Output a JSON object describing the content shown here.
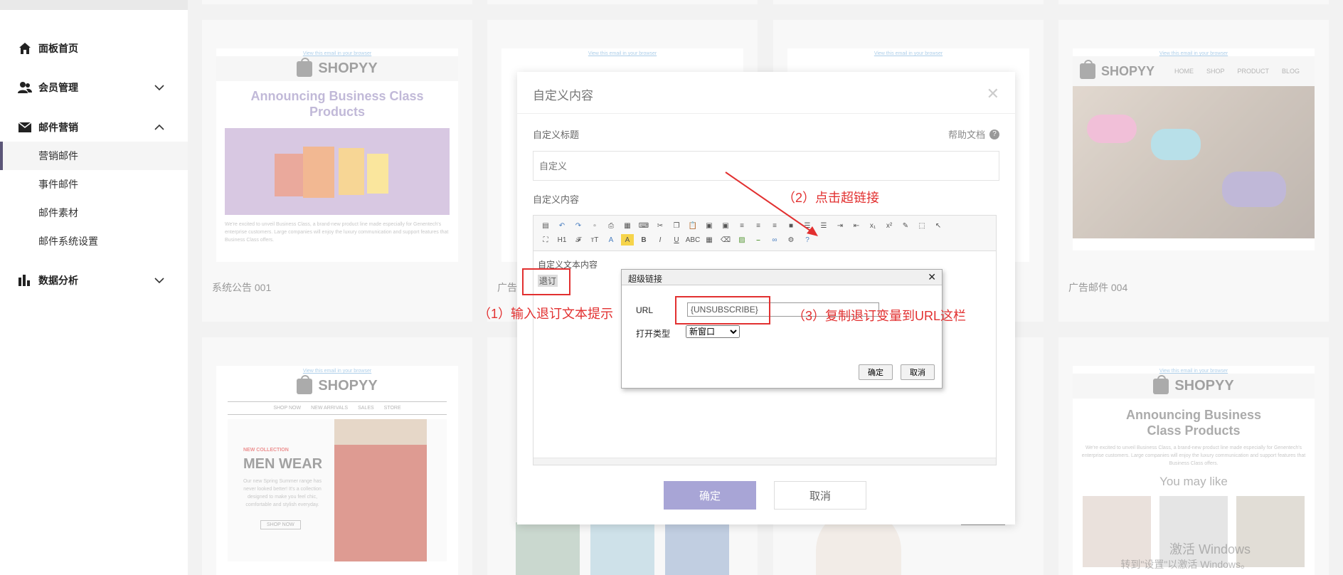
{
  "sidebar": {
    "items": [
      {
        "label": "面板首页",
        "icon": "home-icon"
      },
      {
        "label": "会员管理",
        "icon": "members-icon"
      },
      {
        "label": "邮件营销",
        "icon": "mail-icon"
      },
      {
        "label": "数据分析",
        "icon": "chart-icon"
      }
    ],
    "mail_sub": [
      "营销邮件",
      "事件邮件",
      "邮件素材",
      "邮件系统设置"
    ]
  },
  "cards": {
    "view_link": "View this email in your browser",
    "brand": "SHOPYY",
    "headline": "Announcing Business Class Products",
    "body": "We're excited to unveil Business Class, a brand-new product line made especially for Genentech's enterprise customers. Large companies will enjoy the luxury communication and support features that Business Class offers.",
    "nav": [
      "HOME",
      "SHOP",
      "PRODUCT",
      "BLOG"
    ],
    "nav2": [
      "SHOP NOW",
      "NEW ARRIVALS",
      "SALES",
      "STORE"
    ],
    "new_collection": "NEW COLLECTION",
    "men_wear": "MEN WEAR",
    "men_text": "Our new Spring Summer range has never looked better! It's a collection designed to make you feel chic, comfortable and stylish everyday.",
    "shop_now": "SHOP NOW",
    "you_may_like": "You may like",
    "captions": [
      "系统公告 001",
      "广告",
      "广告邮件 004"
    ]
  },
  "modal": {
    "title": "自定义内容",
    "title_label": "自定义标题",
    "help": "帮助文档",
    "title_placeholder": "自定义",
    "content_label": "自定义内容",
    "editor_line1": "自定义文本内容",
    "editor_line2": "退订",
    "ok": "确定",
    "cancel": "取消"
  },
  "hyperlink": {
    "title": "超级链接",
    "url_label": "URL",
    "url_value": "{UNSUBSCRIBE}",
    "target_label": "打开类型",
    "target_value": "新窗口",
    "ok": "确定",
    "cancel": "取消"
  },
  "annotations": {
    "step1": "（1）输入退订文本提示",
    "step2": "（2）点击超链接",
    "step3": "（3）复制退订变量到URL这栏"
  },
  "watermark": {
    "line1": "激活 Windows",
    "line2": "转到\"设置\"以激活 Windows。"
  },
  "colors": {
    "accent": "#5b5678",
    "annotation": "#e23030",
    "ok_button": "#a8a5d6"
  }
}
